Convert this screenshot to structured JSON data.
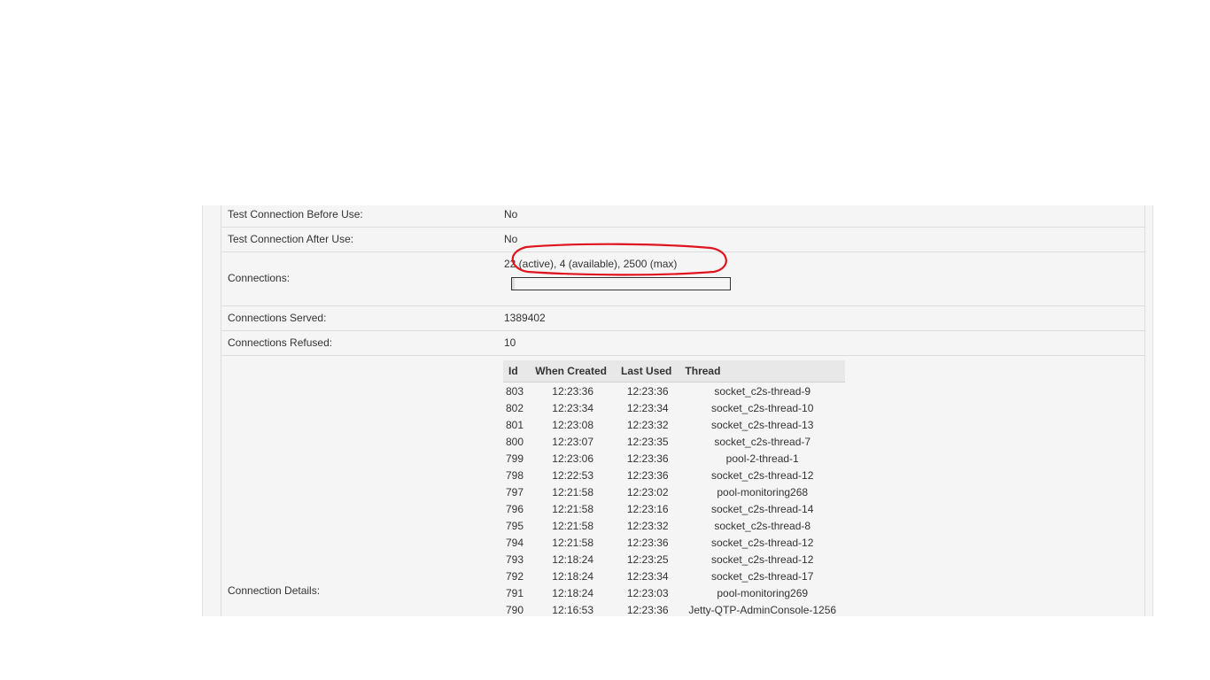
{
  "properties": {
    "test_before_label": "Test Connection Before Use:",
    "test_before_value": "No",
    "test_after_label": "Test Connection After Use:",
    "test_after_value": "No",
    "connections_label": "Connections:",
    "connections_value": "22 (active), 4 (available), 2500 (max)",
    "connections_usage_fraction": 0.0104,
    "served_label": "Connections Served:",
    "served_value": "1389402",
    "refused_label": "Connections Refused:",
    "refused_value": "10",
    "details_label": "Connection Details:"
  },
  "details_table": {
    "headers": [
      "Id",
      "When Created",
      "Last Used",
      "Thread"
    ],
    "rows": [
      [
        "803",
        "12:23:36",
        "12:23:36",
        "socket_c2s-thread-9"
      ],
      [
        "802",
        "12:23:34",
        "12:23:34",
        "socket_c2s-thread-10"
      ],
      [
        "801",
        "12:23:08",
        "12:23:32",
        "socket_c2s-thread-13"
      ],
      [
        "800",
        "12:23:07",
        "12:23:35",
        "socket_c2s-thread-7"
      ],
      [
        "799",
        "12:23:06",
        "12:23:36",
        "pool-2-thread-1"
      ],
      [
        "798",
        "12:22:53",
        "12:23:36",
        "socket_c2s-thread-12"
      ],
      [
        "797",
        "12:21:58",
        "12:23:02",
        "pool-monitoring268"
      ],
      [
        "796",
        "12:21:58",
        "12:23:16",
        "socket_c2s-thread-14"
      ],
      [
        "795",
        "12:21:58",
        "12:23:32",
        "socket_c2s-thread-8"
      ],
      [
        "794",
        "12:21:58",
        "12:23:36",
        "socket_c2s-thread-12"
      ],
      [
        "793",
        "12:18:24",
        "12:23:25",
        "socket_c2s-thread-12"
      ],
      [
        "792",
        "12:18:24",
        "12:23:34",
        "socket_c2s-thread-17"
      ],
      [
        "791",
        "12:18:24",
        "12:23:03",
        "pool-monitoring269"
      ],
      [
        "790",
        "12:16:53",
        "12:23:36",
        "Jetty-QTP-AdminConsole-1256"
      ]
    ]
  },
  "colors": {
    "panel_bg": "#f5f5f5",
    "annotation": "#e0141e",
    "text": "#333333"
  }
}
